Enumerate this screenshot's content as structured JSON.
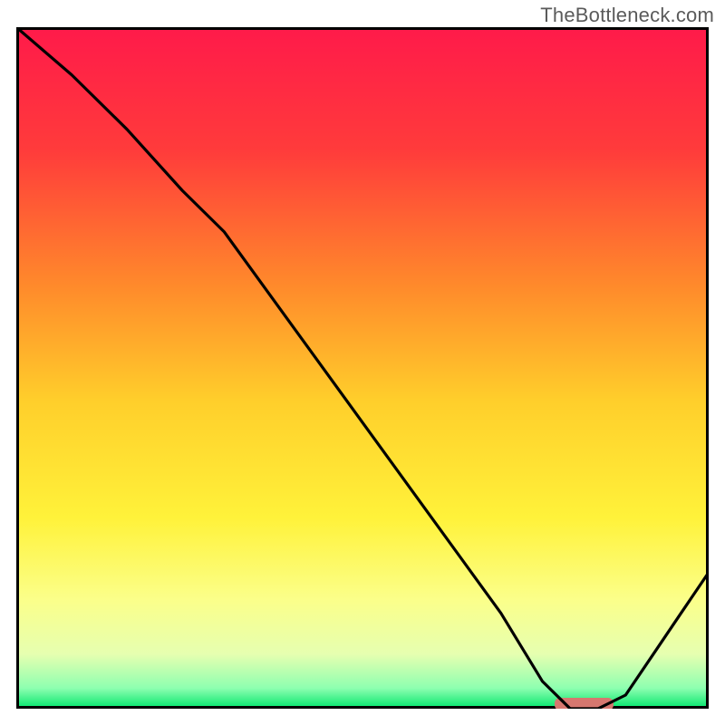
{
  "watermark": "TheBottleneck.com",
  "chart_data": {
    "type": "line",
    "title": "",
    "xlabel": "",
    "ylabel": "",
    "xlim": [
      0,
      100
    ],
    "ylim": [
      0,
      100
    ],
    "grid": false,
    "legend": false,
    "annotations": [],
    "series": [
      {
        "name": "curve",
        "x": [
          0,
          8,
          16,
          24,
          30,
          40,
          50,
          60,
          70,
          76,
          80,
          84,
          88,
          92,
          96,
          100
        ],
        "y": [
          100,
          93,
          85,
          76,
          70,
          56,
          42,
          28,
          14,
          4,
          0,
          0,
          2,
          8,
          14,
          20
        ]
      }
    ],
    "background_gradient": {
      "stops": [
        {
          "offset": 0.0,
          "color": "#ff1a4a"
        },
        {
          "offset": 0.18,
          "color": "#ff3b3b"
        },
        {
          "offset": 0.38,
          "color": "#ff8a2b"
        },
        {
          "offset": 0.55,
          "color": "#ffcf2b"
        },
        {
          "offset": 0.72,
          "color": "#fff23a"
        },
        {
          "offset": 0.84,
          "color": "#fbff8a"
        },
        {
          "offset": 0.92,
          "color": "#e6ffb0"
        },
        {
          "offset": 0.97,
          "color": "#8dffb0"
        },
        {
          "offset": 1.0,
          "color": "#00e56b"
        }
      ]
    },
    "marker": {
      "x_center": 82,
      "width": 8.5,
      "color": "#d6776f"
    },
    "border_color": "#000000",
    "curve_color": "#000000"
  }
}
